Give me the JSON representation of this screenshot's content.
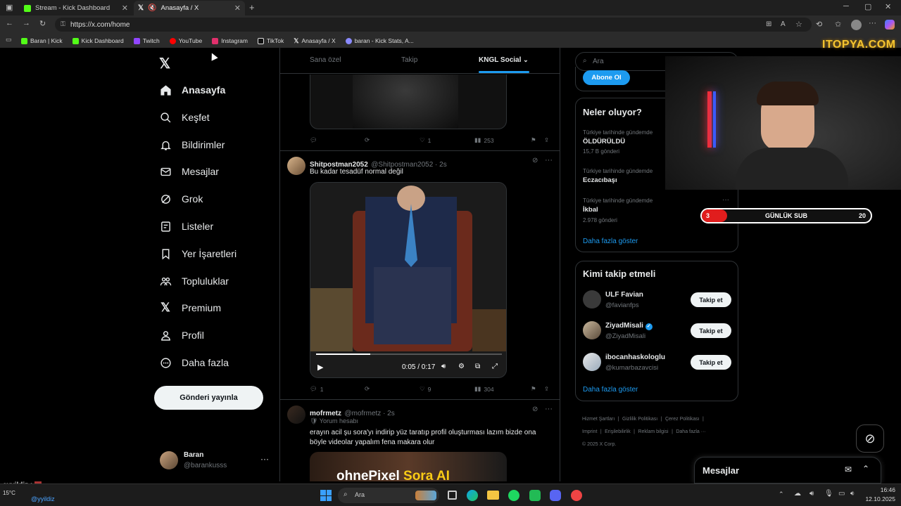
{
  "browser": {
    "tabs": [
      {
        "label": "Stream - Kick Dashboard",
        "icon": "kick-icon"
      },
      {
        "label": "Anasayfa / X",
        "icon": "x-logo-icon"
      }
    ],
    "url": "https://x.com/home",
    "favorites": [
      {
        "label": "Baran | Kick",
        "color": "#53fc18"
      },
      {
        "label": "Kick Dashboard",
        "color": "#53fc18"
      },
      {
        "label": "Twitch",
        "color": "#9146ff"
      },
      {
        "label": "YouTube",
        "color": "#ff0000"
      },
      {
        "label": "Instagram",
        "color": "#e1306c"
      },
      {
        "label": "TikTok",
        "color": "#ffffff"
      },
      {
        "label": "Anasayfa / X",
        "color": "#ffffff"
      },
      {
        "label": "baran - Kick Stats, A...",
        "color": "#8a8aff"
      }
    ]
  },
  "nav": {
    "items": [
      {
        "label": "Anasayfa",
        "icon": "home-icon"
      },
      {
        "label": "Keşfet",
        "icon": "search-icon"
      },
      {
        "label": "Bildirimler",
        "icon": "bell-icon"
      },
      {
        "label": "Mesajlar",
        "icon": "mail-icon"
      },
      {
        "label": "Grok",
        "icon": "grok-icon"
      },
      {
        "label": "Listeler",
        "icon": "list-icon"
      },
      {
        "label": "Yer İşaretleri",
        "icon": "bookmark-icon"
      },
      {
        "label": "Topluluklar",
        "icon": "communities-icon"
      },
      {
        "label": "Premium",
        "icon": "x-logo-icon"
      },
      {
        "label": "Profil",
        "icon": "person-icon"
      },
      {
        "label": "Daha fazla",
        "icon": "more-circle-icon"
      }
    ],
    "post_button": "Gönderi yayınla",
    "account": {
      "name": "Baran",
      "handle": "@barankusss"
    }
  },
  "feed": {
    "tabs": [
      "Sana özel",
      "Takip",
      "KNGL Social"
    ],
    "tweet0": {
      "replies": "",
      "likes": "1",
      "views": "253"
    },
    "tweet1": {
      "name": "Shitpostman2052",
      "handle": "@Shitpostman2052 · 2s",
      "text": "Bu kadar tesadüf normal değil",
      "video_time": "0:05 / 0:17",
      "replies": "1",
      "likes": "9",
      "views": "304"
    },
    "tweet2": {
      "name": "mofrmetz",
      "handle": "@mofrmetz · 2s",
      "badge": "Yorum hesabı",
      "text_line1": "erayın acil şu sora'yı indirip yüz taratıp profil oluşturması lazım bizde ona",
      "text_line2": "böyle videolar yapalım fena makara olur",
      "image_text1": "ohnePixel",
      "image_text2": "Sora AI"
    }
  },
  "sidebar": {
    "search_placeholder": "Ara",
    "subscribe_button": "Abone Ol",
    "trends_title": "Neler oluyor?",
    "trends": [
      {
        "category": "Türkiye tarihinde gündemde",
        "title": "ÖLDÜRÜLDÜ",
        "count": "15,7 B gönderi"
      },
      {
        "category": "Türkiye tarihinde gündemde",
        "title": "Eczacıbaşı",
        "count": ""
      },
      {
        "category": "Türkiye tarihinde gündemde",
        "title": "İkbal",
        "count": "2.978 gönderi"
      }
    ],
    "show_more": "Daha fazla göster",
    "who_to_follow_title": "Kimi takip etmeli",
    "follow": [
      {
        "name": "ULF Favian",
        "handle": "@favianfps"
      },
      {
        "name": "ZiyadMisali",
        "handle": "@ZiyadMisali"
      },
      {
        "name": "ibocanhaskologlu",
        "handle": "@kumarbazavcisi"
      }
    ],
    "follow_button": "Takip et",
    "show_more2": "Daha fazla göster",
    "footer_links": [
      "Hizmet Şartları",
      "Gizlilik Politikası",
      "Çerez Politikası",
      "Imprint",
      "Erişilebilirlik",
      "Reklam bilgisi",
      "Daha fazla ···"
    ],
    "copyright": "© 2025 X Corp."
  },
  "messages": {
    "title": "Mesajlar"
  },
  "overlay": {
    "brand": "ITOPYA.COM",
    "sub_label": "GÜNLÜK SUB",
    "sub_current": "3",
    "sub_goal": "20",
    "sub_progress": 0.15,
    "chat_user": "eyyildiz :",
    "chat_user2": "@yyildiz"
  },
  "taskbar": {
    "search": "Ara",
    "weather": "15°C",
    "time": "16:46",
    "date": "12.10.2025"
  }
}
